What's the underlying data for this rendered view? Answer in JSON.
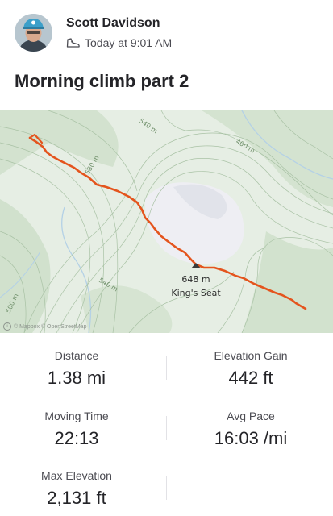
{
  "header": {
    "athlete_name": "Scott Davidson",
    "timestamp": "Today at 9:01 AM",
    "activity_icon": "hiking-shoe-icon"
  },
  "activity": {
    "title": "Morning climb part 2"
  },
  "map": {
    "contour_labels": [
      "540 m",
      "400 m",
      "580 m",
      "540 m",
      "500 m"
    ],
    "peak_elevation": "648 m",
    "peak_name": "King's Seat",
    "attribution": "© Mapbox © OpenStreetMap",
    "route_color": "#e4541d"
  },
  "stats": {
    "distance": {
      "label": "Distance",
      "value": "1.38 mi"
    },
    "elevation_gain": {
      "label": "Elevation Gain",
      "value": "442 ft"
    },
    "moving_time": {
      "label": "Moving Time",
      "value": "22:13"
    },
    "avg_pace": {
      "label": "Avg Pace",
      "value": "16:03 /mi"
    },
    "max_elevation": {
      "label": "Max Elevation",
      "value": "2,131 ft"
    }
  }
}
